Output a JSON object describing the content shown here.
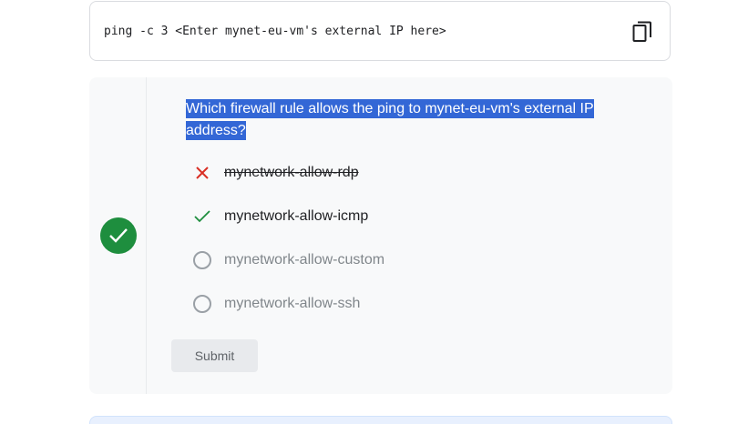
{
  "code_block": {
    "command": "ping -c 3 <Enter mynet-eu-vm's external IP here>",
    "copy_icon": "copy-icon"
  },
  "quiz": {
    "status_icon": "check-circle-icon",
    "status_color": "#1e8e3e",
    "question": "Which firewall rule allows the ping to mynet-eu-vm's external IP address?",
    "options": [
      {
        "label": "mynetwork-allow-rdp",
        "state": "incorrect",
        "icon": "cross-icon"
      },
      {
        "label": "mynetwork-allow-icmp",
        "state": "correct",
        "icon": "check-icon"
      },
      {
        "label": "mynetwork-allow-custom",
        "state": "unselected",
        "icon": "radio-icon"
      },
      {
        "label": "mynetwork-allow-ssh",
        "state": "unselected",
        "icon": "radio-icon"
      }
    ],
    "submit_label": "Submit"
  },
  "colors": {
    "correct": "#1e8e3e",
    "incorrect": "#d93025",
    "selection_highlight": "#3367d6"
  }
}
